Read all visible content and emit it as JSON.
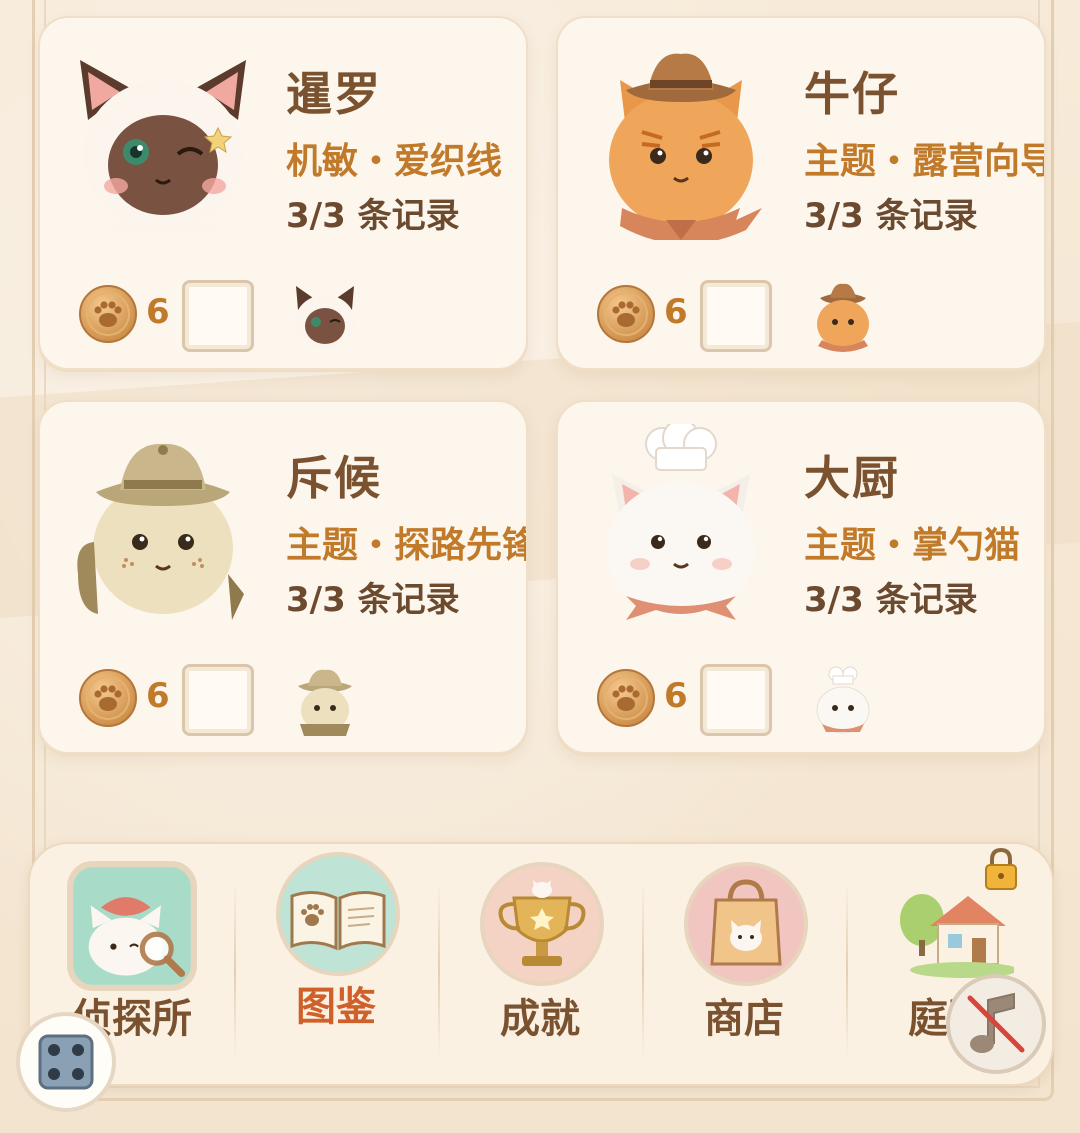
{
  "cats": [
    {
      "name": "暹罗",
      "theme": "机敏・爱织线",
      "records": "3/3 条记录",
      "coins": "6"
    },
    {
      "name": "牛仔",
      "theme": "主题・露营向导",
      "records": "3/3 条记录",
      "coins": "6"
    },
    {
      "name": "斥候",
      "theme": "主题・探路先锋",
      "records": "3/3 条记录",
      "coins": "6"
    },
    {
      "name": "大厨",
      "theme": "主题・掌勺猫",
      "records": "3/3 条记录",
      "coins": "6"
    }
  ],
  "nav": {
    "items": [
      {
        "label": "侦探所",
        "icon": "detective-cat-icon"
      },
      {
        "label": "图鉴",
        "icon": "book-icon",
        "active": true
      },
      {
        "label": "成就",
        "icon": "trophy-icon"
      },
      {
        "label": "商店",
        "icon": "shopping-bag-icon"
      },
      {
        "label": "庭院",
        "icon": "house-icon",
        "locked": true
      }
    ]
  },
  "controls": {
    "music_icon": "music-muted-icon",
    "menu_icon": "grid-menu-icon"
  },
  "colors": {
    "card_bg": "#fdf6ec",
    "name": "#7a5230",
    "theme": "#c07a2a",
    "active_nav": "#d0602a"
  }
}
